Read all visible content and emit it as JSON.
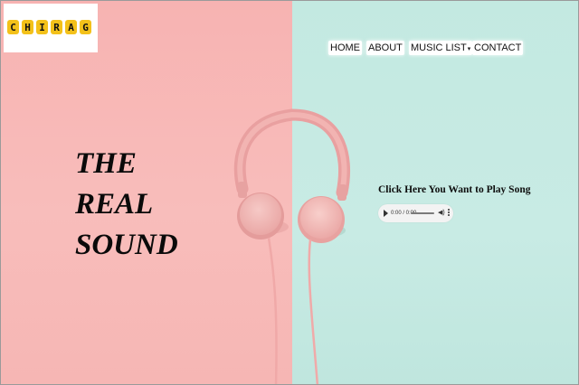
{
  "logo": {
    "letters": [
      "C",
      "H",
      "I",
      "R",
      "A",
      "G"
    ]
  },
  "nav": {
    "home": "HOME",
    "about": "ABOUT",
    "music_list": "MUSIC LIST",
    "contact": "CONTACT"
  },
  "hero": {
    "line1": "THE",
    "line2": "REAL",
    "line3": "SOUND"
  },
  "player": {
    "label": "Click Here You Want to Play Song",
    "time": "0:00 / 0:00"
  },
  "colors": {
    "left_bg": "#f7b5b3",
    "right_bg": "#c4e9e2",
    "logo_tile": "#f3c11a"
  }
}
